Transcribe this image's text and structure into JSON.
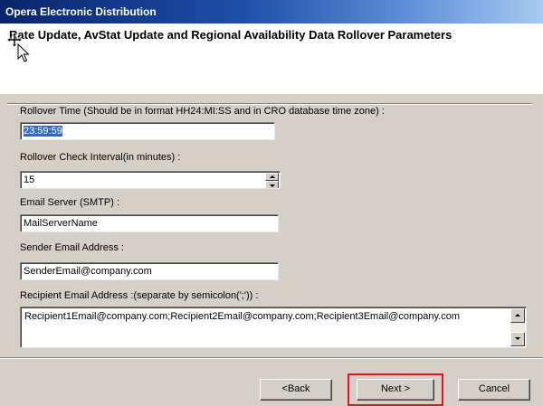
{
  "window": {
    "title": "Opera Electronic Distribution"
  },
  "header": {
    "title": "Rate Update, AvStat Update and Regional Availability Data Rollover Parameters"
  },
  "form": {
    "rollover_time": {
      "label": "Rollover Time (Should be in format HH24:MI:SS and in CRO database time zone) :",
      "value": "23:59:59"
    },
    "check_interval": {
      "label": "Rollover Check Interval(in minutes) :",
      "value": "15"
    },
    "email_server": {
      "label": "Email Server (SMTP) :",
      "value": "MailServerName"
    },
    "sender_email": {
      "label": "Sender Email Address :",
      "value": "SenderEmail@company.com"
    },
    "recipient_email": {
      "label": "Recipient Email Address :(separate by semicolon(';')) :",
      "value": "Recipient1Email@company.com;Recipient2Email@company.com;Recipient3Email@company.com"
    }
  },
  "buttons": {
    "back": "<Back",
    "next": "Next >",
    "cancel": "Cancel"
  },
  "colors": {
    "title_bar": "#0a246a",
    "dialog_face": "#d4d0c8",
    "selection": "#316ac5",
    "highlight": "#e0141c"
  }
}
